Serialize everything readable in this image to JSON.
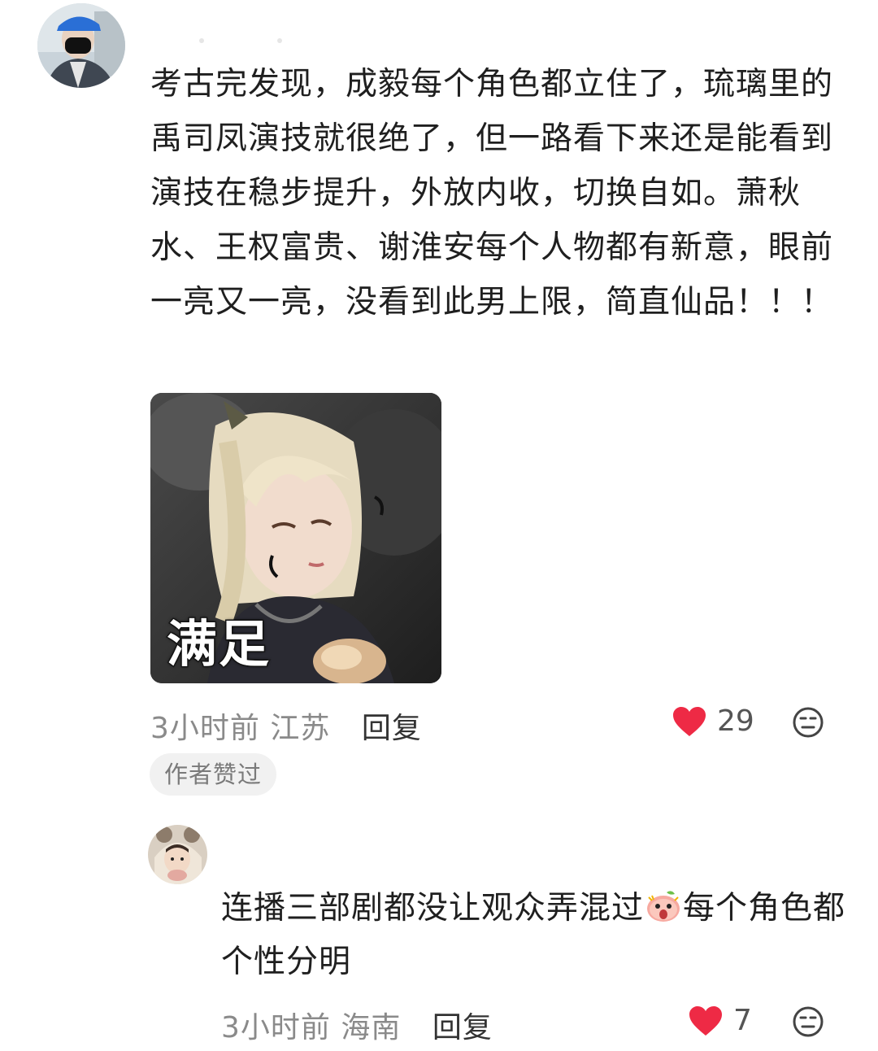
{
  "comment": {
    "text": "考古完发现，成毅每个角色都立住了，琉璃里的禹司凤演技就很绝了，但一路看下来还是能看到演技在稳步提升，外放内收，切换自如。萧秋水、王权富贵、谢淮安每个人物都有新意，眼前一亮又一亮，没看到此男上限，简直仙品！！！",
    "sticker_caption": "满足",
    "time": "3小时前",
    "location": "江苏",
    "reply_label": "回复",
    "likes": "29",
    "badge": "作者赞过"
  },
  "reply": {
    "text_before": "连播三部剧都没让观众弄混过",
    "text_after": "每个角色都个性分明",
    "time": "3小时前",
    "location": "海南",
    "reply_label": "回复",
    "likes": "7"
  },
  "colors": {
    "heart": "#ee2a45",
    "meta": "#8a8a8a",
    "badge_bg": "#f1f1f1"
  },
  "icons": {
    "like": "heart-icon",
    "dislike": "dislike-face-icon",
    "inline_emoji": "shocked-face-emoji"
  }
}
